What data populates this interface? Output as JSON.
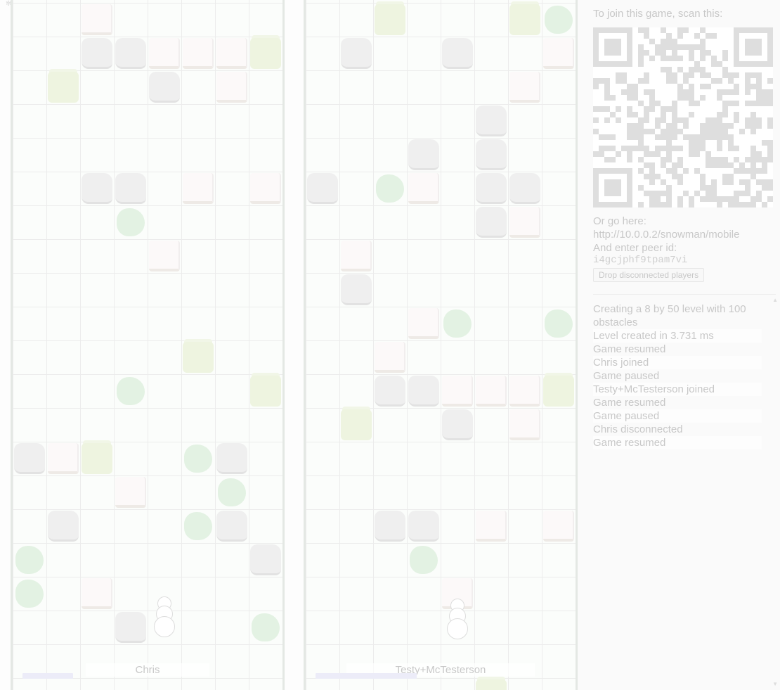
{
  "players": [
    {
      "name": "Chris",
      "progress": 0.19
    },
    {
      "name": "Testy+McTesterson",
      "progress": 0.38
    }
  ],
  "sidebar": {
    "join_label": "To join this game, scan this:",
    "go_here_label": "Or go here:",
    "url": "http://10.0.0.2/snowman/mobile",
    "peer_label": "And enter peer id:",
    "peer_id": "i4gcjphf9tpam7vi",
    "drop_button": "Drop disconnected players"
  },
  "log": [
    "Creating a 8 by 50 level with 100 obstacles",
    "Level created in 3.731 ms",
    "Game resumed",
    "Chris joined",
    "Game paused",
    "Testy+McTesterson joined",
    "Game resumed",
    "Game paused",
    "Chris disconnected",
    "Game resumed"
  ],
  "icons": {
    "tree": "tree-icon",
    "rock": "rock-icon",
    "snow": "snow-block-icon",
    "grass": "grass-icon",
    "snowman": "snowman-icon"
  },
  "colors": {
    "grid": "#ececec",
    "rock": "#efefef",
    "tree": "#e3f2e3",
    "grass": "#eef4e0",
    "progress": "#ececf8"
  }
}
